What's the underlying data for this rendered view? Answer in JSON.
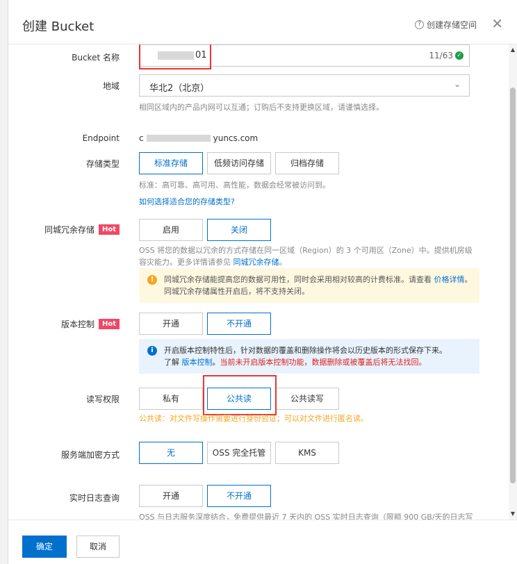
{
  "dialog": {
    "title": "创建 Bucket",
    "help_link": "创建存储空间",
    "help_icon": "?",
    "close_icon": "✕"
  },
  "form": {
    "bucket_name": {
      "label": "Bucket 名称",
      "value": "01",
      "counter": "11/63",
      "check_icon": "✓"
    },
    "region": {
      "label": "地域",
      "value": "华北2（北京）",
      "hint": "相同区域内的产品内网可以互通；订购后不支持更换区域，请谨慎选择。"
    },
    "endpoint": {
      "label": "Endpoint",
      "value_prefix": "c",
      "value_suffix": "yuncs.com"
    },
    "storage_class": {
      "label": "存储类型",
      "options": [
        "标准存储",
        "低频访问存储",
        "归档存储"
      ],
      "selected": "标准存储",
      "hint": "标准：高可靠、高可用、高性能，数据会经常被访问到。",
      "link": "如何选择适合您的存储类型?"
    },
    "zrs": {
      "label": "同城冗余存储",
      "badge": "Hot",
      "options": [
        "启用",
        "关闭"
      ],
      "selected": "关闭",
      "hint": "OSS 将您的数据以冗余的方式存储在同一区域（Region）的 3 个可用区（Zone）中。提供机房级容灾能力。更多详情请参见",
      "hint_link": "同城冗余存储",
      "hint_end": "。",
      "notice": "同城冗余存储能提高您的数据可用性，同时会采用相对较高的计费标准。请查看",
      "notice_link": "价格详情",
      "notice_end": "。同城冗余存储属性开启后，将不支持关闭。",
      "notice_icon": "!"
    },
    "versioning": {
      "label": "版本控制",
      "badge": "Hot",
      "options": [
        "开通",
        "不开通"
      ],
      "selected": "不开通",
      "notice_line1": "开启版本控制特性后，针对数据的覆盖和删除操作将会以历史版本的形式保存下来。",
      "notice_prefix": "了解",
      "notice_link": "版本控制",
      "notice_sep": "。",
      "notice_warning": "当前未开启版本控制功能，数据删除或被覆盖后将无法找回。",
      "notice_icon": "i"
    },
    "acl": {
      "label": "读写权限",
      "options": [
        "私有",
        "公共读",
        "公共读写"
      ],
      "selected": "公共读",
      "tip": "公共读：对文件写操作需要进行身份验证；可以对文件进行匿名读。"
    },
    "encryption": {
      "label": "服务端加密方式",
      "options": [
        "无",
        "OSS 完全托管",
        "KMS"
      ],
      "selected": "无"
    },
    "log_query": {
      "label": "实时日志查询",
      "options": [
        "开通",
        "不开通"
      ],
      "selected": "不开通",
      "hint": "OSS 与日志服务深度结合，免费提供最近 7 天内的 OSS 实时日志查询（限额 900 GB/天的日志写"
    }
  },
  "footer": {
    "confirm": "确定",
    "cancel": "取消"
  },
  "scroll": {
    "up": "▲",
    "down": "▼"
  },
  "colors": {
    "accent": "#0070cc",
    "hot": "#f04864",
    "highlight": "#e33333",
    "warning": "#f5a623"
  }
}
